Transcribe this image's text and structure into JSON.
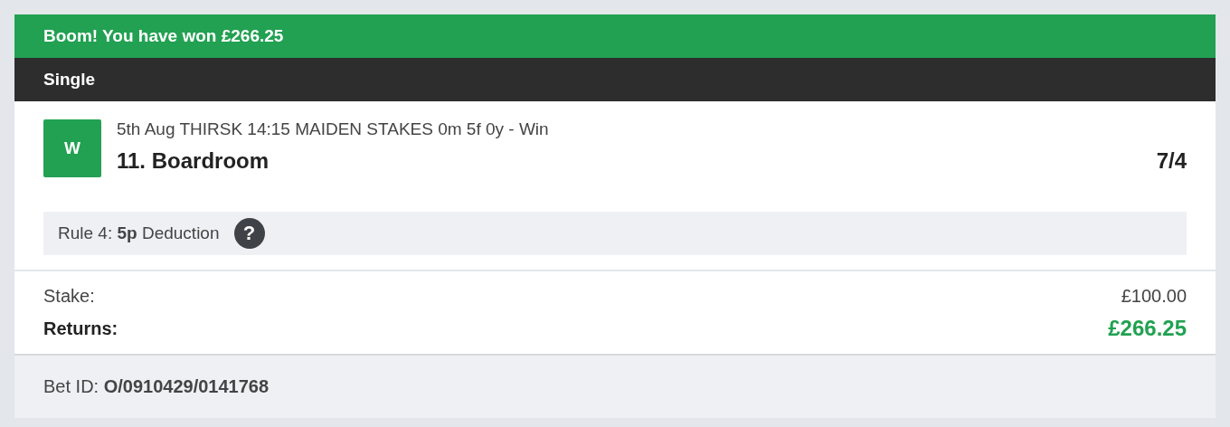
{
  "banner": {
    "text": "Boom! You have won £266.25"
  },
  "bet_type": "Single",
  "selection": {
    "result_badge": "W",
    "event": "5th Aug THIRSK 14:15 MAIDEN STAKES 0m 5f 0y - Win",
    "name": "11. Boardroom",
    "odds": "7/4"
  },
  "rule4": {
    "text": "Rule 4: **5p** Deduction",
    "help_icon": "?"
  },
  "totals": [
    {
      "label": "Stake:",
      "value": "£100.00",
      "kind": "plain"
    },
    {
      "label": "Returns:",
      "value": "£266.25",
      "kind": "highlight"
    }
  ],
  "footer": {
    "text": "Bet ID: **O/0910429/0141768**"
  }
}
